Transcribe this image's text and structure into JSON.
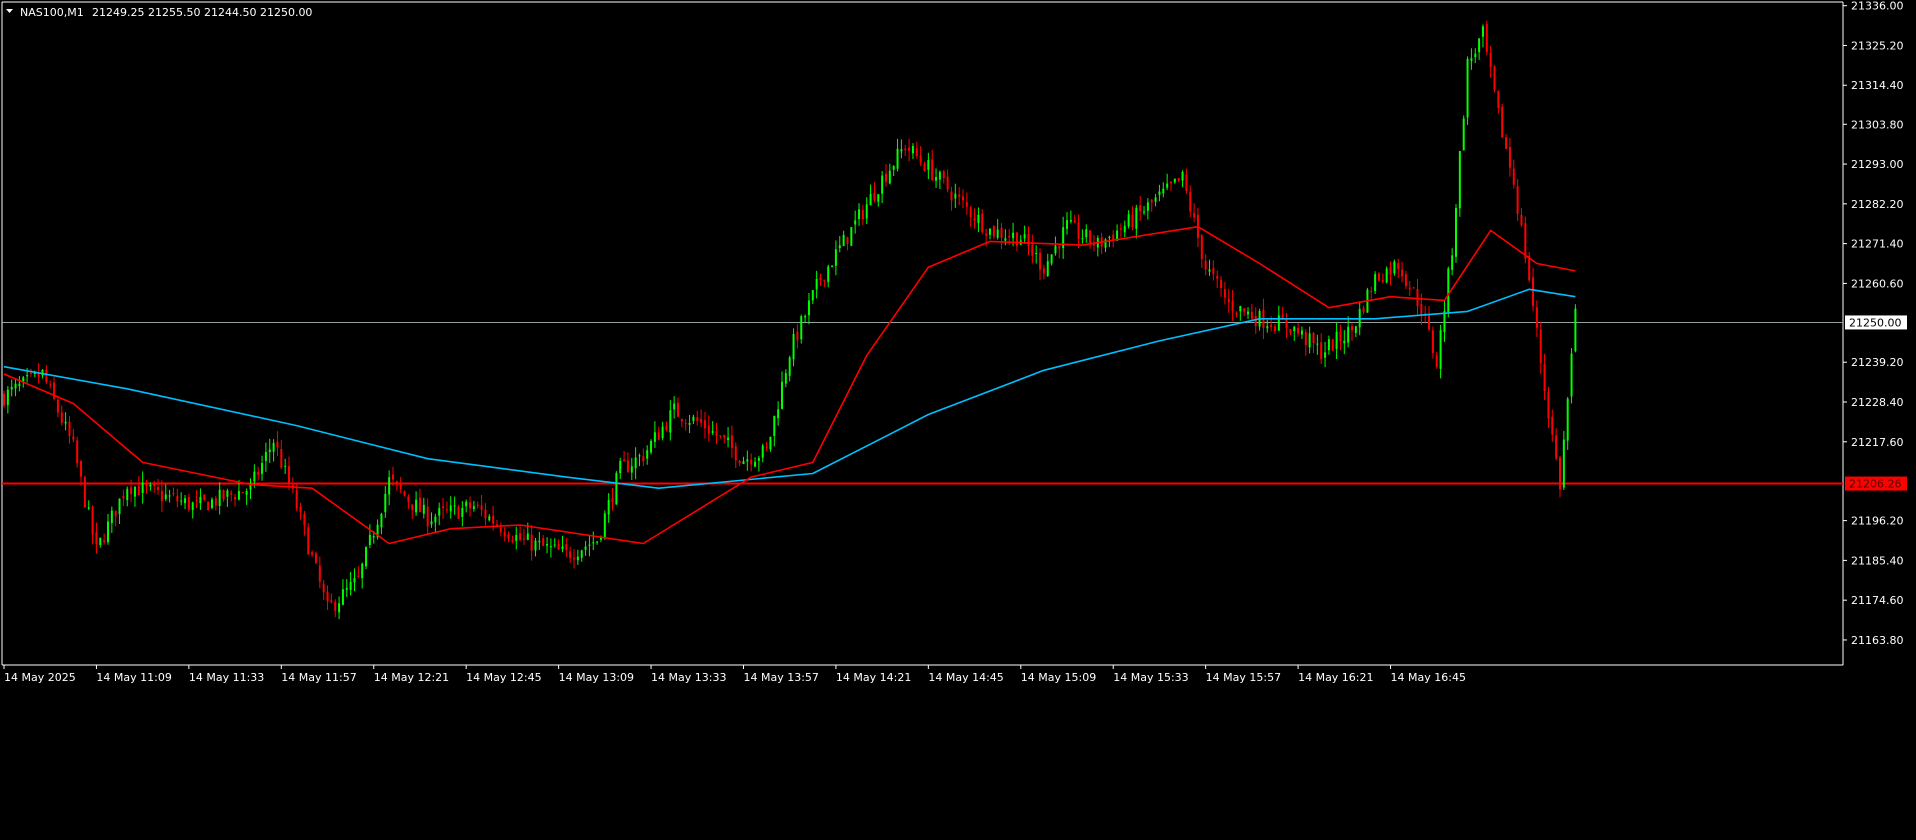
{
  "symbol_header": {
    "symbol": "NAS100,M1",
    "ohlc": "21249.25 21255.50 21244.50 21250.00"
  },
  "colors": {
    "background": "#000000",
    "bull_candle": "#00ff00",
    "bear_candle": "#ff0000",
    "ma_fast": "#ff0000",
    "ma_slow": "#00bfff",
    "bid_line": "#8fa3a3",
    "hline": "#ff0000",
    "axis": "#ffffff"
  },
  "chart_data": {
    "type": "candlestick",
    "timeframe": "M1",
    "ylim": [
      21157.0,
      21337.0
    ],
    "y_ticks": [
      "21336.00",
      "21325.20",
      "21314.40",
      "21303.80",
      "21293.00",
      "21282.20",
      "21271.40",
      "21260.60",
      "21239.20",
      "21228.40",
      "21217.60",
      "21196.20",
      "21185.40",
      "21174.60",
      "21163.80"
    ],
    "x_ticks": [
      "14 May 2025",
      "14 May 11:09",
      "14 May 11:33",
      "14 May 11:57",
      "14 May 12:21",
      "14 May 12:45",
      "14 May 13:09",
      "14 May 13:33",
      "14 May 13:57",
      "14 May 14:21",
      "14 May 14:45",
      "14 May 15:09",
      "14 May 15:33",
      "14 May 15:57",
      "14 May 16:21",
      "14 May 16:45"
    ],
    "current_price": "21250.00",
    "horizontal_line": "21206.26",
    "price_path": [
      {
        "t": 0,
        "p": 21230
      },
      {
        "t": 10,
        "p": 21236
      },
      {
        "t": 18,
        "p": 21216
      },
      {
        "t": 24,
        "p": 21188
      },
      {
        "t": 32,
        "p": 21206
      },
      {
        "t": 50,
        "p": 21200
      },
      {
        "t": 64,
        "p": 21205
      },
      {
        "t": 70,
        "p": 21218
      },
      {
        "t": 76,
        "p": 21200
      },
      {
        "t": 84,
        "p": 21172
      },
      {
        "t": 92,
        "p": 21180
      },
      {
        "t": 100,
        "p": 21207
      },
      {
        "t": 110,
        "p": 21197
      },
      {
        "t": 122,
        "p": 21200
      },
      {
        "t": 134,
        "p": 21191
      },
      {
        "t": 146,
        "p": 21187
      },
      {
        "t": 154,
        "p": 21191
      },
      {
        "t": 160,
        "p": 21210
      },
      {
        "t": 166,
        "p": 21214
      },
      {
        "t": 174,
        "p": 21226
      },
      {
        "t": 182,
        "p": 21222
      },
      {
        "t": 192,
        "p": 21213
      },
      {
        "t": 198,
        "p": 21215
      },
      {
        "t": 204,
        "p": 21242
      },
      {
        "t": 212,
        "p": 21262
      },
      {
        "t": 220,
        "p": 21275
      },
      {
        "t": 228,
        "p": 21289
      },
      {
        "t": 234,
        "p": 21298
      },
      {
        "t": 240,
        "p": 21292
      },
      {
        "t": 248,
        "p": 21283
      },
      {
        "t": 256,
        "p": 21275
      },
      {
        "t": 264,
        "p": 21273
      },
      {
        "t": 270,
        "p": 21265
      },
      {
        "t": 276,
        "p": 21276
      },
      {
        "t": 284,
        "p": 21271
      },
      {
        "t": 292,
        "p": 21277
      },
      {
        "t": 300,
        "p": 21284
      },
      {
        "t": 306,
        "p": 21289
      },
      {
        "t": 312,
        "p": 21265
      },
      {
        "t": 318,
        "p": 21255
      },
      {
        "t": 326,
        "p": 21251
      },
      {
        "t": 334,
        "p": 21249
      },
      {
        "t": 342,
        "p": 21242
      },
      {
        "t": 350,
        "p": 21248
      },
      {
        "t": 356,
        "p": 21262
      },
      {
        "t": 362,
        "p": 21266
      },
      {
        "t": 368,
        "p": 21254
      },
      {
        "t": 372,
        "p": 21239
      },
      {
        "t": 376,
        "p": 21270
      },
      {
        "t": 380,
        "p": 21320
      },
      {
        "t": 384,
        "p": 21328
      },
      {
        "t": 388,
        "p": 21306
      },
      {
        "t": 392,
        "p": 21288
      },
      {
        "t": 396,
        "p": 21262
      },
      {
        "t": 400,
        "p": 21232
      },
      {
        "t": 404,
        "p": 21206
      },
      {
        "t": 408,
        "p": 21252
      }
    ],
    "ma_fast": [
      {
        "t": 0,
        "p": 21236
      },
      {
        "t": 18,
        "p": 21228
      },
      {
        "t": 36,
        "p": 21212
      },
      {
        "t": 64,
        "p": 21206
      },
      {
        "t": 80,
        "p": 21205
      },
      {
        "t": 100,
        "p": 21190
      },
      {
        "t": 116,
        "p": 21194
      },
      {
        "t": 134,
        "p": 21195
      },
      {
        "t": 166,
        "p": 21190
      },
      {
        "t": 194,
        "p": 21208
      },
      {
        "t": 210,
        "p": 21212
      },
      {
        "t": 224,
        "p": 21241
      },
      {
        "t": 240,
        "p": 21265
      },
      {
        "t": 256,
        "p": 21272
      },
      {
        "t": 280,
        "p": 21271
      },
      {
        "t": 310,
        "p": 21276
      },
      {
        "t": 326,
        "p": 21266
      },
      {
        "t": 344,
        "p": 21254
      },
      {
        "t": 360,
        "p": 21257
      },
      {
        "t": 374,
        "p": 21256
      },
      {
        "t": 386,
        "p": 21275
      },
      {
        "t": 398,
        "p": 21266
      },
      {
        "t": 408,
        "p": 21264
      }
    ],
    "ma_slow": [
      {
        "t": 0,
        "p": 21238
      },
      {
        "t": 32,
        "p": 21232
      },
      {
        "t": 76,
        "p": 21222
      },
      {
        "t": 110,
        "p": 21213
      },
      {
        "t": 146,
        "p": 21208
      },
      {
        "t": 170,
        "p": 21205
      },
      {
        "t": 210,
        "p": 21209
      },
      {
        "t": 240,
        "p": 21225
      },
      {
        "t": 270,
        "p": 21237
      },
      {
        "t": 300,
        "p": 21245
      },
      {
        "t": 326,
        "p": 21251
      },
      {
        "t": 356,
        "p": 21251
      },
      {
        "t": 380,
        "p": 21253
      },
      {
        "t": 396,
        "p": 21259
      },
      {
        "t": 408,
        "p": 21257
      }
    ]
  }
}
